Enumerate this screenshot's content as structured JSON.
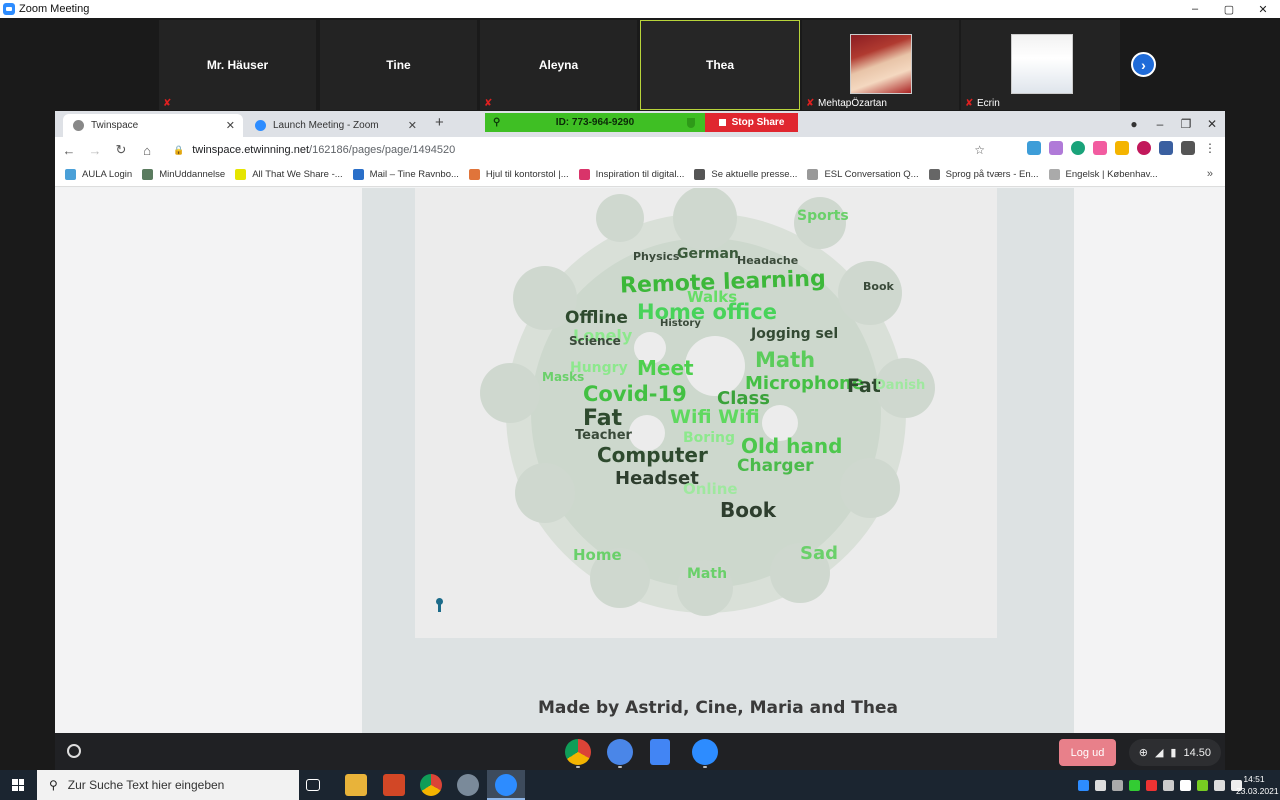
{
  "zoom": {
    "window_title": "Zoom Meeting",
    "participants": [
      {
        "name": "Mr. Häuser"
      },
      {
        "name": "Tine"
      },
      {
        "name": "Aleyna"
      },
      {
        "name": "Thea"
      },
      {
        "name": "MehtapÖzartan"
      },
      {
        "name": "Ecrin"
      }
    ],
    "share_id": "ID: 773-964-9290",
    "stop_share_label": "Stop Share",
    "next_icon": "chevron-right-icon",
    "window_controls": [
      "–",
      "▢",
      "✕"
    ]
  },
  "browser": {
    "tabs": [
      {
        "label": "Twinspace",
        "active": true
      },
      {
        "label": "Launch Meeting - Zoom",
        "active": false
      }
    ],
    "url_host": "twinspace.etwinning.net",
    "url_path": "/162186/pages/page/1494520",
    "bookmarks": [
      {
        "label": "AULA Login",
        "color": "#4aa0d8"
      },
      {
        "label": "MinUddannelse",
        "color": "#5a7b5f"
      },
      {
        "label": "All That We Share -...",
        "color": "#e5e500"
      },
      {
        "label": "Mail – Tine Ravnbo...",
        "color": "#2a6fc9"
      },
      {
        "label": "Hjul til kontorstol |...",
        "color": "#e0743a"
      },
      {
        "label": "Inspiration til digital...",
        "color": "#d9346a"
      },
      {
        "label": "Se aktuelle presse...",
        "color": "#555555"
      },
      {
        "label": "ESL Conversation Q...",
        "color": "#999999"
      },
      {
        "label": "Sprog på tværs - En...",
        "color": "#666666"
      },
      {
        "label": "Engelsk | Københav...",
        "color": "#aaaaaa"
      }
    ]
  },
  "slide": {
    "caption": "Made by Astrid, Cine, Maria and Thea",
    "words": [
      {
        "t": "Remote learning",
        "c": "#3db83a"
      },
      {
        "t": "Home office",
        "c": "#48d35a"
      },
      {
        "t": "Offline",
        "c": "#2e4a2e"
      },
      {
        "t": "Walks",
        "c": "#66dd66"
      },
      {
        "t": "Lonely",
        "c": "#8de88d"
      },
      {
        "t": "German",
        "c": "#3a5a3a"
      },
      {
        "t": "Jogging sel",
        "c": "#344a34"
      },
      {
        "t": "Math",
        "c": "#5bcc5b"
      },
      {
        "t": "Meet",
        "c": "#4dd04d"
      },
      {
        "t": "Hungry",
        "c": "#8de88d"
      },
      {
        "t": "Covid-19",
        "c": "#43c043"
      },
      {
        "t": "Microphone",
        "c": "#45c045"
      },
      {
        "t": "Fat",
        "c": "#2e4a2e"
      },
      {
        "t": "Danish",
        "c": "#9fe89f"
      },
      {
        "t": "Class",
        "c": "#3aa23a"
      },
      {
        "t": "Wifi Wifi",
        "c": "#5fd95f"
      },
      {
        "t": "Fat",
        "c": "#2e4a2e"
      },
      {
        "t": "Teacher",
        "c": "#3a4a3a"
      },
      {
        "t": "Boring",
        "c": "#8de88d"
      },
      {
        "t": "Old hand",
        "c": "#4dc84d"
      },
      {
        "t": "Computer",
        "c": "#2e4a2e"
      },
      {
        "t": "Charger",
        "c": "#4bbb4b"
      },
      {
        "t": "Headset",
        "c": "#2e3e2e"
      },
      {
        "t": "Online",
        "c": "#9fe89f"
      },
      {
        "t": "Book",
        "c": "#2e3e2e"
      },
      {
        "t": "Sad",
        "c": "#6ad06a"
      },
      {
        "t": "Home",
        "c": "#6ad06a"
      },
      {
        "t": "Math",
        "c": "#6ad06a"
      },
      {
        "t": "Sports",
        "c": "#6ad06a"
      },
      {
        "t": "Science",
        "c": "#3a4a3a"
      },
      {
        "t": "Headache",
        "c": "#3a4a3a"
      },
      {
        "t": "Physics",
        "c": "#3a4a3a"
      },
      {
        "t": "History",
        "c": "#3a4a3a"
      },
      {
        "t": "Book",
        "c": "#3a4a3a"
      },
      {
        "t": "Masks",
        "c": "#6ad06a"
      }
    ]
  },
  "shelf": {
    "logout_label": "Log ud",
    "tray_time": "14.50"
  },
  "taskbar": {
    "search_placeholder": "Zur Suche Text hier eingeben",
    "time": "14:51",
    "date": "23.03.2021"
  }
}
